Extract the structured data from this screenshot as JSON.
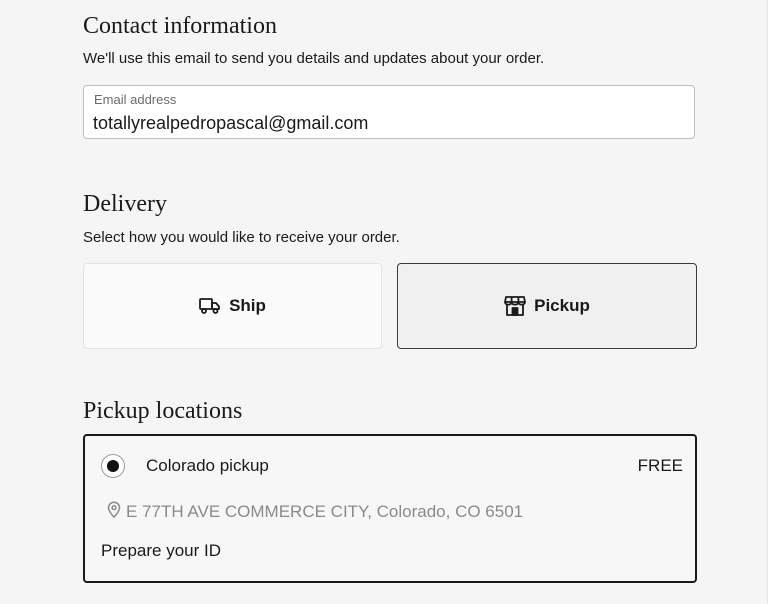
{
  "contact": {
    "title": "Contact information",
    "subtitle": "We'll use this email to send you details and updates about your order.",
    "email_label": "Email address",
    "email_value": "totallyrealpedropascal@gmail.com"
  },
  "delivery": {
    "title": "Delivery",
    "subtitle": "Select how you would like to receive your order.",
    "options": [
      {
        "label": "Ship",
        "icon": "truck-icon",
        "selected": false
      },
      {
        "label": "Pickup",
        "icon": "store-icon",
        "selected": true
      }
    ]
  },
  "pickup": {
    "title": "Pickup locations",
    "location": {
      "name": "Colorado pickup",
      "price": "FREE",
      "address": "E 77TH AVE COMMERCE CITY, Colorado, CO 6501",
      "note": "Prepare your ID",
      "selected": true
    }
  },
  "colors": {
    "background": "#f5f5f5",
    "text": "#1a1a1a",
    "muted": "#8a8a8a",
    "selected_border": "#1a1a1a"
  }
}
